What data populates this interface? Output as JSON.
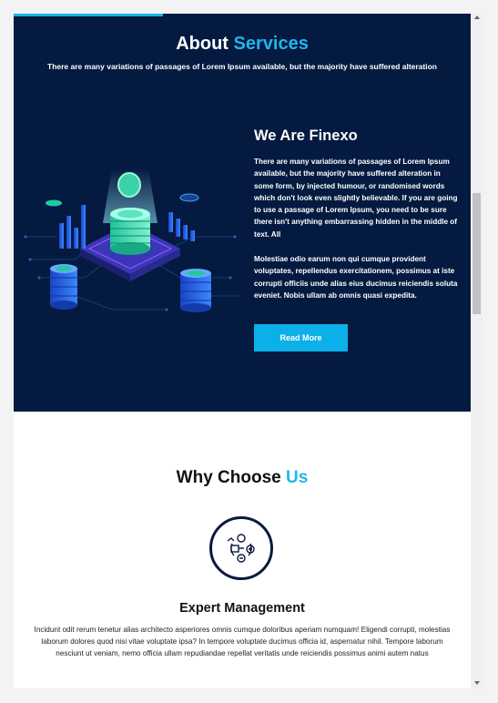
{
  "about": {
    "title_prefix": "About",
    "title_highlight": "Services",
    "subtitle": "There are many variations of passages of Lorem Ipsum available, but the majority have suffered alteration"
  },
  "intro": {
    "title": "We Are Finexo",
    "paragraph1": "There are many variations of passages of Lorem Ipsum available, but the majority have suffered alteration in some form, by injected humour, or randomised words which don't look even slightly believable. If you are going to use a passage of Lorem Ipsum, you need to be sure there isn't anything embarrassing hidden in the middle of text. All",
    "paragraph2": "Molestiae odio earum non qui cumque provident voluptates, repellendus exercitationem, possimus at iste corrupti officiis unde alias eius ducimus reiciendis soluta eveniet. Nobis ullam ab omnis quasi expedita.",
    "button_label": "Read More"
  },
  "why": {
    "title_prefix": "Why Choose",
    "title_highlight": "Us"
  },
  "feature": {
    "icon": "management-icon",
    "title": "Expert Management",
    "description": "Incidunt odit rerum tenetur alias architecto asperiores omnis cumque doloribus aperiam numquam! Eligendi corrupti, molestias laborum dolores quod nisi vitae voluptate ipsa? In tempore voluptate ducimus officia id, aspernatur nihil. Tempore laborum nesciunt ut veniam, nemo officia ullam repudiandae repellat veritatis unde reiciendis possimus animi autem natus"
  },
  "colors": {
    "dark_bg": "#041a40",
    "accent": "#1eb7ec",
    "button": "#0cb0e8"
  }
}
